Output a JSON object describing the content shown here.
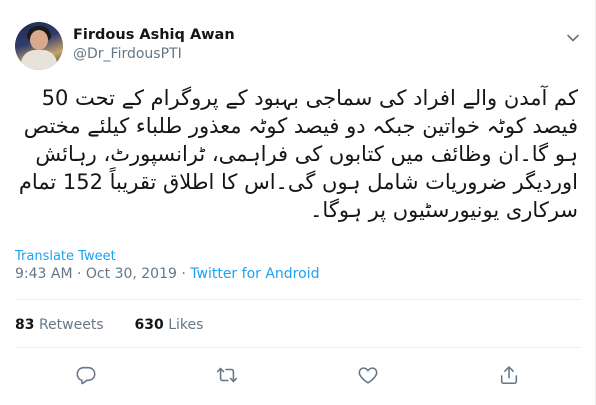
{
  "tweet": {
    "display_name": "Firdous Ashiq Awan",
    "handle": "@Dr_FirdousPTI",
    "text": "کم آمدن والے افراد کی سماجی بہبود کے پروگرام کے تحت 50 فیصد کوٹہ خواتین جبکہ دو فیصد کوٹہ معذور طلباء کیلئے مختص ہو گا۔ان وظائف میں کتابوں کی فراہمی، ٹرانسپورٹ، رہائش اوردیگر ضروریات شامل ہوں گی۔اس کا اطلاق تقریباً 152 تمام سرکاری یونیورسٹیوں پر ہوگا۔",
    "translate_label": "Translate Tweet",
    "time": "9:43 AM",
    "date": "Oct 30, 2019",
    "separator": "·",
    "source": "Twitter for Android",
    "retweets_count": "83",
    "retweets_label": "Retweets",
    "likes_count": "630",
    "likes_label": "Likes"
  },
  "icons": {
    "avatar": "profile-photo",
    "more": "chevron-down-icon",
    "reply": "reply-icon",
    "retweet": "retweet-icon",
    "like": "heart-icon",
    "share": "share-icon"
  },
  "colors": {
    "text": "#14171a",
    "muted": "#657786",
    "link": "#1da1f2",
    "divider": "#e6ecf0"
  }
}
